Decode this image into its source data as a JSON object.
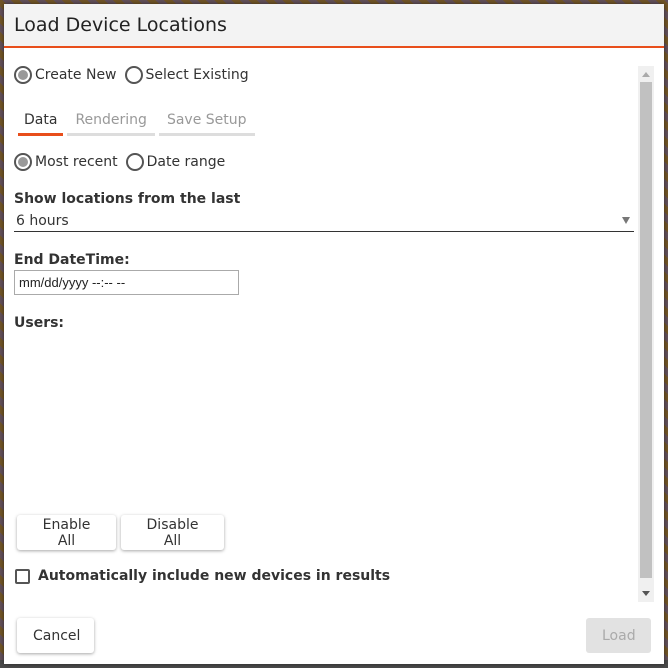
{
  "dialog": {
    "title": "Load Device Locations"
  },
  "mode": {
    "options": [
      {
        "label": "Create New",
        "checked": true
      },
      {
        "label": "Select Existing",
        "checked": false
      }
    ]
  },
  "tabs": [
    {
      "label": "Data",
      "active": true
    },
    {
      "label": "Rendering",
      "active": false
    },
    {
      "label": "Save Setup",
      "active": false
    }
  ],
  "range": {
    "options": [
      {
        "label": "Most recent",
        "checked": true
      },
      {
        "label": "Date range",
        "checked": false
      }
    ]
  },
  "show_last": {
    "label": "Show locations from the last",
    "value": "6 hours"
  },
  "end_datetime": {
    "label": "End DateTime:",
    "placeholder": "mm/dd/yyyy --:-- --"
  },
  "users": {
    "label": "Users:"
  },
  "buttons": {
    "enable_all": "Enable All",
    "disable_all": "Disable All",
    "cancel": "Cancel",
    "load": "Load"
  },
  "auto_include": {
    "label": "Automatically include new devices in results",
    "checked": false
  },
  "colors": {
    "accent": "#e84e1b"
  }
}
